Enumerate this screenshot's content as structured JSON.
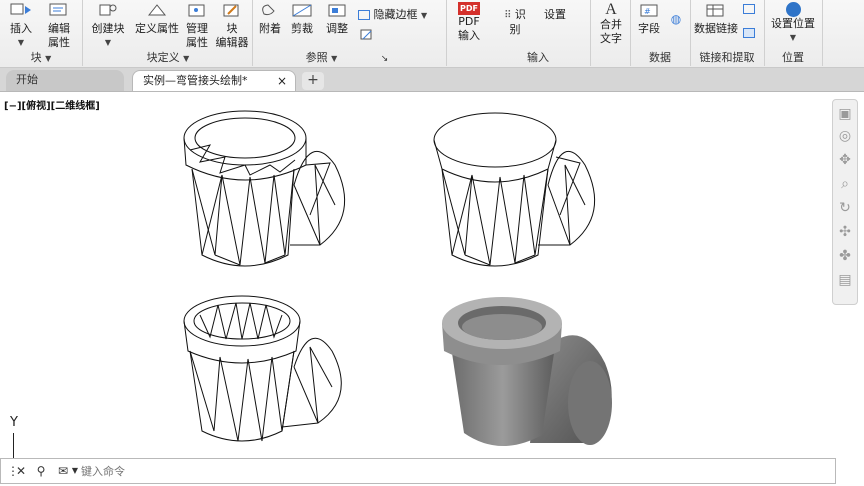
{
  "ribbon": {
    "groups": {
      "block": "块",
      "block_definition": "块定义",
      "reference": "参照",
      "import": "输入",
      "data": "数据",
      "linking": "链接和提取",
      "location": "位置"
    },
    "buttons": {
      "insert": "插入",
      "edit_attributes": "编辑\n属性",
      "create_block": "创建块",
      "define_attributes": "定义属性",
      "manage_attributes": "管理\n属性",
      "block_editor": "块\n编辑器",
      "attach": "附着",
      "clip": "剪裁",
      "adjust": "调整",
      "hide_frames": "隐藏边框",
      "pdf_import": "PDF\n输入",
      "recognize": "识别",
      "settings": "设置",
      "merge_text": "合并\n文字",
      "field": "字段",
      "data_link": "数据链接",
      "set_location": "设置位置"
    }
  },
  "tabs": [
    {
      "label": "开始"
    },
    {
      "label": "实例—弯管接头绘制*"
    }
  ],
  "tab_close": "×",
  "tab_add": "+",
  "viewport": {
    "label": "[−][俯视][二维线框]"
  },
  "ucs": {
    "y_label": "Y"
  },
  "command": {
    "placeholder": "键入命令"
  },
  "colors": {
    "ribbon_bg": "#ececec",
    "tab_bg": "#d6d6d6",
    "canvas_bg": "#ffffff",
    "shaded_model": "#8a8a8a"
  }
}
